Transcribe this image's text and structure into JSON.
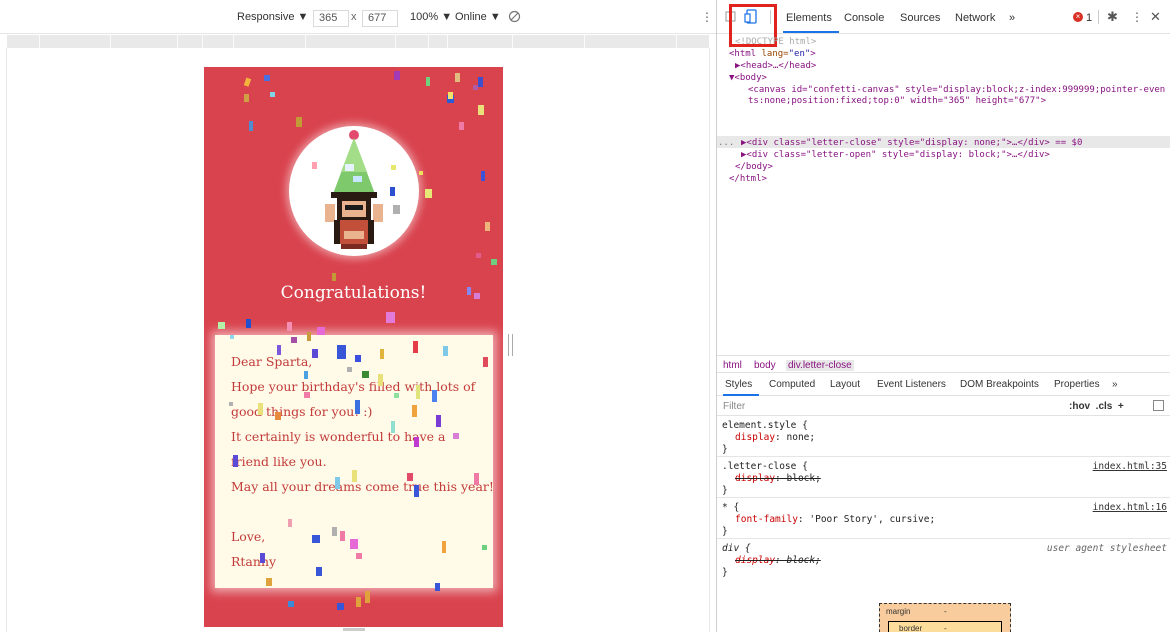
{
  "toolbar": {
    "device": "Responsive ▼",
    "width": "365",
    "times": "x",
    "height": "677",
    "zoom": "100% ▼",
    "network": "Online ▼"
  },
  "page": {
    "heading": "Congratulations!",
    "letter_lines": [
      "Dear Sparta,",
      "Hope your birthday's filled with lots of",
      "good things for you! :)",
      "It certainly is wonderful to have a",
      "friend like you.",
      "May all your dreams come true this year!",
      "",
      "Love,",
      "Rtanny"
    ]
  },
  "devtools": {
    "tabs": [
      "Elements",
      "Console",
      "Sources",
      "Network",
      "»"
    ],
    "error_count": "1",
    "dom": {
      "line0": "<!DOCTYPE html>",
      "line1_tag": "<html",
      "line1_attr": " lang=",
      "line1_val": "\"en\"",
      "line1_end": ">",
      "line2": "▶<head>…</head>",
      "line3": "▼<body>",
      "line4_a": "<canvas id=\"confetti-canvas\" style=\"display:block;z-index:999999;pointer-even",
      "line4_b": "ts:none;position:fixed;top:0\" width=\"365\" height=\"677\">",
      "line5": "▶<div class=\"letter-close\" style=\"display: none;\">…</div> == $0",
      "line6": "▶<div class=\"letter-open\" style=\"display: block;\">…</div>",
      "line7": "</body>",
      "line8": "</html>",
      "dots": "..."
    },
    "breadcrumbs": [
      "html",
      "body",
      "div.letter-close"
    ],
    "styles_tabs": [
      "Styles",
      "Computed",
      "Layout",
      "Event Listeners",
      "DOM Breakpoints",
      "Properties",
      "»"
    ],
    "filter_placeholder": "Filter",
    "filter_tools": ":hov  .cls  +",
    "rules": [
      {
        "selector": "element.style {",
        "prop": "display",
        "value": "none;",
        "source": ""
      },
      {
        "selector": ".letter-close {",
        "prop": "display",
        "value": "block;",
        "source": "index.html:35"
      },
      {
        "selector": "* {",
        "prop": "font-family",
        "value": "'Poor Story', cursive;",
        "source": "index.html:16"
      },
      {
        "selector": "div {",
        "prop": "display",
        "value": "block;",
        "source": "user agent stylesheet"
      }
    ],
    "closing_brace": "}",
    "boxmodel": {
      "margin": "margin",
      "border": "border",
      "dash": "-"
    }
  }
}
